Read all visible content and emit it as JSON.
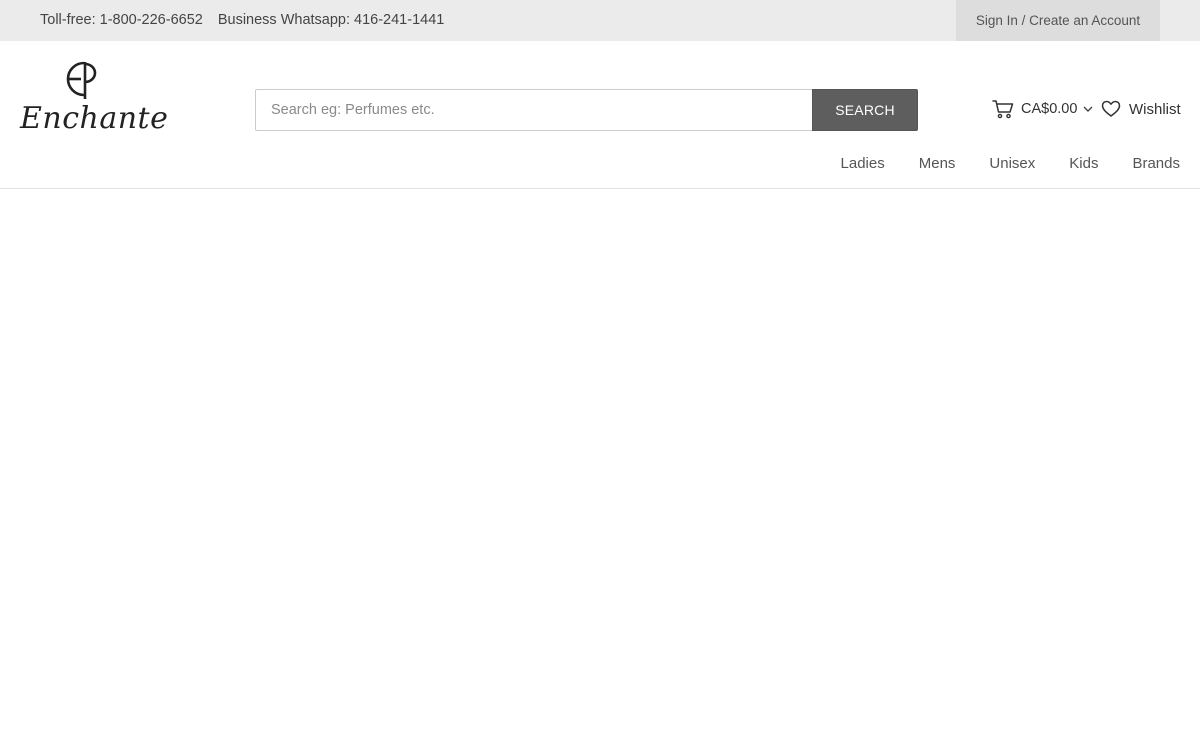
{
  "topbar": {
    "tollfree": "Toll-free: 1-800-226-6652",
    "whatsapp": "Business Whatsapp: 416-241-1441",
    "signin": "Sign In / Create an Account"
  },
  "logo": {
    "monogram": "EP",
    "word": "Enchante"
  },
  "search": {
    "placeholder": "Search eg: Perfumes etc.",
    "value": "",
    "button_label": "SEARCH"
  },
  "cart": {
    "icon": "cart-icon",
    "amount": "CA$0.00",
    "chevron_icon": "chevron-down-icon"
  },
  "wishlist": {
    "icon": "heart-icon",
    "label": "Wishlist"
  },
  "nav": {
    "items": [
      {
        "label": "Ladies"
      },
      {
        "label": "Mens"
      },
      {
        "label": "Unisex"
      },
      {
        "label": "Kids"
      },
      {
        "label": "Brands"
      }
    ]
  },
  "colors": {
    "topbar_bg": "#ebebeb",
    "signin_bg": "#dddddd",
    "search_button_bg": "#5e5e5e",
    "text": "#333333"
  }
}
